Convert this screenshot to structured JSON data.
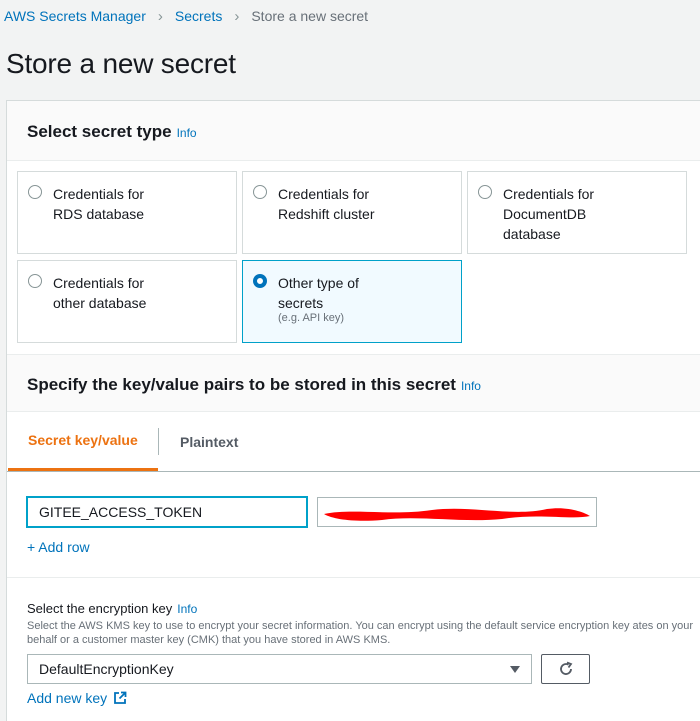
{
  "breadcrumb": {
    "items": [
      "AWS Secrets Manager",
      "Secrets"
    ],
    "current": "Store a new secret"
  },
  "page": {
    "title": "Store a new secret"
  },
  "secret_type": {
    "heading": "Select secret type",
    "info": "Info",
    "options": [
      {
        "label": "Credentials for\nRDS database",
        "selected": false
      },
      {
        "label": "Credentials for\nRedshift cluster",
        "selected": false
      },
      {
        "label": "Credentials for\nDocumentDB\ndatabase",
        "selected": false
      },
      {
        "label": "Credentials for\nother database",
        "selected": false
      },
      {
        "label": "Other type of\nsecrets",
        "sub": "(e.g. API key)",
        "selected": true
      }
    ]
  },
  "key_value": {
    "heading": "Specify the key/value pairs to be stored in this secret",
    "info": "Info",
    "tabs": [
      {
        "label": "Secret key/value",
        "active": true
      },
      {
        "label": "Plaintext",
        "active": false
      }
    ],
    "key_value_input": "GITEE_ACCESS_TOKEN",
    "add_row": "+ Add row"
  },
  "encryption": {
    "label": "Select the encryption key",
    "info": "Info",
    "description": "Select the AWS KMS key to use to encrypt your secret information. You can encrypt using the default service encryption key ates on your behalf or a customer master key (CMK) that you have stored in AWS KMS.",
    "selected_key": "DefaultEncryptionKey",
    "add_new_key": "Add new key"
  },
  "colors": {
    "link": "#0073bb",
    "tab_active": "#ec7211",
    "selected_border": "#00a1c9",
    "redaction": "#ff0000"
  }
}
